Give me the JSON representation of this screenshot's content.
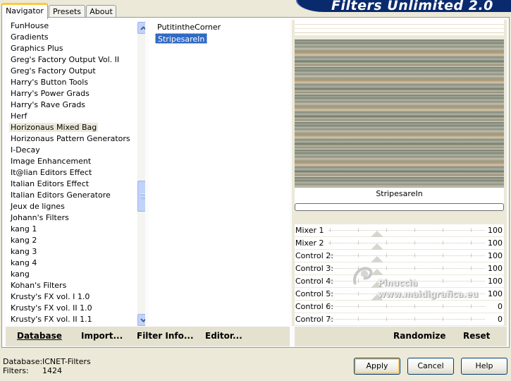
{
  "tabs": [
    {
      "label": "Navigator",
      "active": true
    },
    {
      "label": "Presets",
      "active": false
    },
    {
      "label": "About",
      "active": false
    }
  ],
  "banner": {
    "title": "Filters Unlimited 2.0"
  },
  "categories": {
    "items": [
      "FunHouse",
      "Gradients",
      "Graphics Plus",
      "Greg's Factory Output Vol. II",
      "Greg's Factory Output",
      "Harry's Button Tools",
      "Harry's Power Grads",
      "Harry's Rave Grads",
      "Herf",
      "Horizonaus Mixed Bag",
      "Horizonaus Pattern Generators",
      "I-Decay",
      "Image Enhancement",
      "It@lian Editors Effect",
      "Italian Editors Effect",
      "Italian Editors Generatore",
      "Jeux de lignes",
      "Johann's Filters",
      "kang 1",
      "kang 2",
      "kang 3",
      "kang 4",
      "kang",
      "Kohan's Filters",
      "Krusty's FX vol. I 1.0",
      "Krusty's FX vol. II 1.0",
      "Krusty's FX vol. II 1.1"
    ],
    "selected": "Horizonaus Mixed Bag"
  },
  "filters": {
    "items": [
      "PutitintheCorner",
      "StripesareIn"
    ],
    "selected": "StripesareIn"
  },
  "preview": {
    "filter_name": "StripesareIn"
  },
  "controls": [
    {
      "name": "Mixer 1",
      "value": "100"
    },
    {
      "name": "Mixer 2",
      "value": "100"
    },
    {
      "name": "Control 2:",
      "value": "100"
    },
    {
      "name": "Control 3:",
      "value": "100"
    },
    {
      "name": "Control 4:",
      "value": "100"
    },
    {
      "name": "Control 5:",
      "value": "100"
    },
    {
      "name": "Control 6:",
      "value": "0"
    },
    {
      "name": "Control 7:",
      "value": "0"
    }
  ],
  "watermark": {
    "line1": "Pinuccia",
    "line2": "www.maidigrafica.eu"
  },
  "left_buttons": {
    "database": "Database",
    "import": "Import...",
    "filter_info": "Filter Info...",
    "editor": "Editor..."
  },
  "right_buttons": {
    "randomize": "Randomize",
    "reset": "Reset"
  },
  "status": {
    "database_label": "Database:",
    "database_value": "ICNET-Filters",
    "filters_label": "Filters:",
    "filters_value": "1424"
  },
  "dialog_buttons": {
    "apply": "Apply",
    "cancel": "Cancel",
    "help": "Help"
  },
  "colors": {
    "background": "#ece9d8",
    "selection": "#316ac5",
    "banner": "#0a2a6e",
    "tab_highlight": "#ffc83c"
  }
}
